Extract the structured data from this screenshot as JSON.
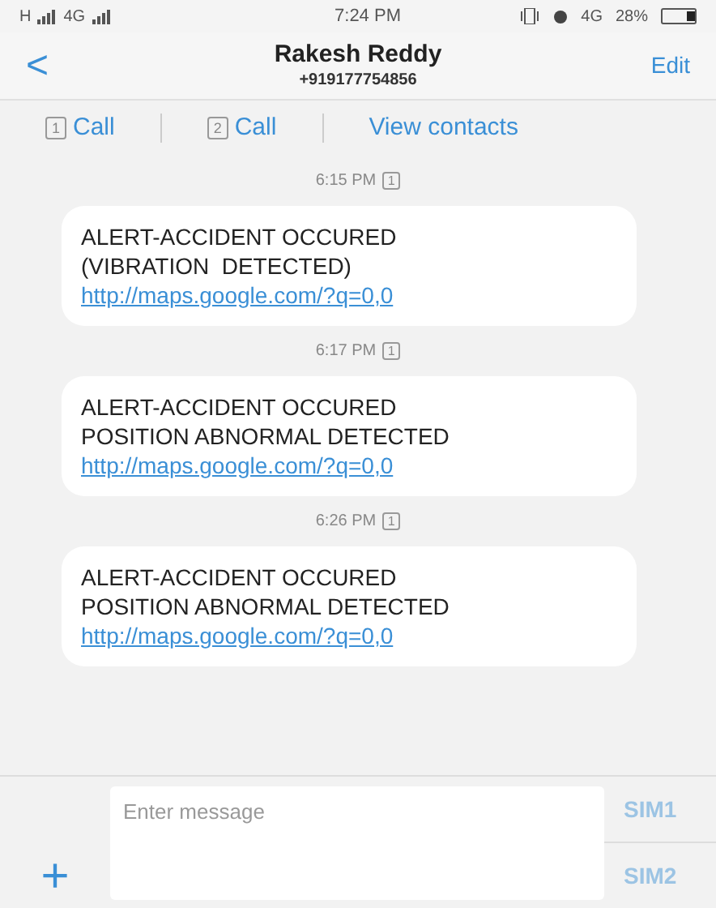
{
  "status_bar": {
    "network_1": "H",
    "network_2": "4G",
    "time": "7:24 PM",
    "network_3": "4G",
    "battery": "28%"
  },
  "header": {
    "back": "<",
    "contact_name": "Rakesh Reddy",
    "phone": "+919177754856",
    "edit": "Edit"
  },
  "actions": [
    {
      "sim": "1",
      "label": "Call"
    },
    {
      "sim": "2",
      "label": "Call"
    },
    {
      "label": "View contacts"
    }
  ],
  "messages": [
    {
      "time": "6:15 PM",
      "sim": "1",
      "lines": [
        "ALERT-ACCIDENT OCCURED",
        "(VIBRATION  DETECTED)"
      ],
      "link": "http://maps.google.com/?q=0,0"
    },
    {
      "time": "6:17 PM",
      "sim": "1",
      "lines": [
        "ALERT-ACCIDENT OCCURED",
        "POSITION ABNORMAL DETECTED"
      ],
      "link": "http://maps.google.com/?q=0,0"
    },
    {
      "time": "6:26 PM",
      "sim": "1",
      "lines": [
        "ALERT-ACCIDENT OCCURED",
        "POSITION ABNORMAL DETECTED"
      ],
      "link": "http://maps.google.com/?q=0,0"
    }
  ],
  "composer": {
    "add": "+",
    "placeholder": "Enter message",
    "send_buttons": [
      "SIM1",
      "SIM2"
    ]
  }
}
